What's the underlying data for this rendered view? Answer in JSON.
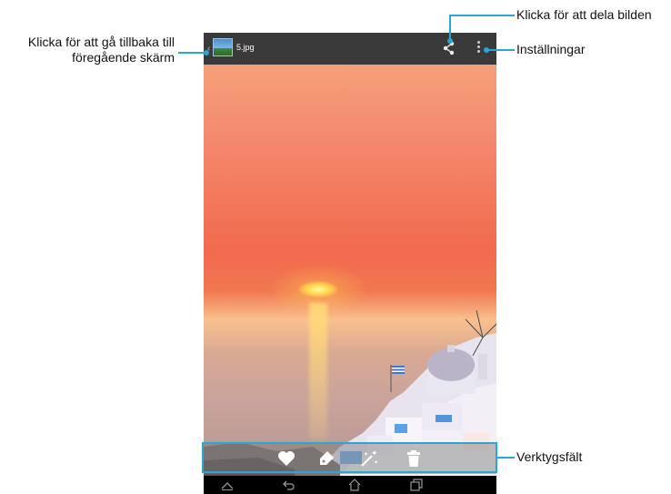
{
  "app": {
    "filename": "5.jpg"
  },
  "callouts": {
    "back_line1": "Klicka för att gå tillbaka till",
    "back_line2": "föregående skärm",
    "share": "Klicka för att dela bilden",
    "settings": "Inställningar",
    "toolbar": "Verktygsfält"
  },
  "icons": {
    "back": "chevron-left-icon",
    "thumbnail": "gallery-thumbnail-icon",
    "share": "share-icon",
    "settings": "overflow-menu-icon",
    "favorite": "heart-icon",
    "tag": "tag-icon",
    "effects": "magic-wand-icon",
    "delete": "trash-icon",
    "nav_up": "chevron-up-icon",
    "nav_back": "back-arrow-icon",
    "nav_home": "home-icon",
    "nav_recent": "recent-apps-icon"
  },
  "colors": {
    "accent": "#2aa6d6",
    "topbar": "#3a3a3a"
  }
}
